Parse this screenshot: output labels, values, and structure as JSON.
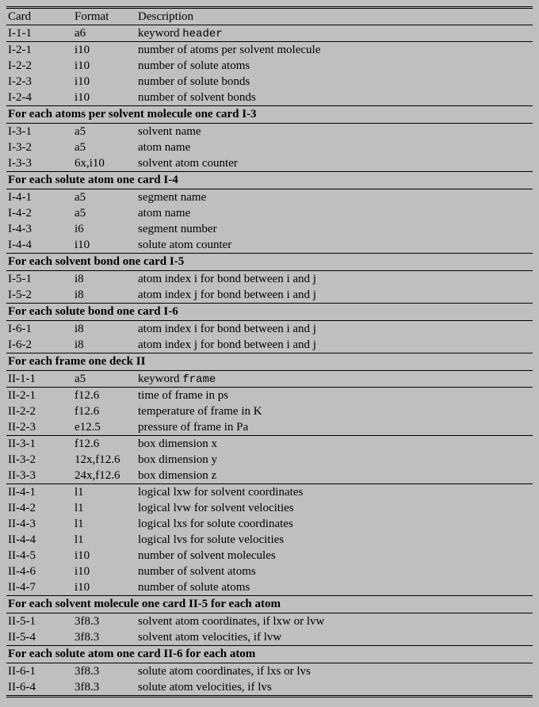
{
  "columns": {
    "card": "Card",
    "format": "Format",
    "description": "Description"
  },
  "rows": [
    {
      "t": "hdr"
    },
    {
      "t": "row",
      "card": "I-1-1",
      "fmt": "a6",
      "desc_pre": "keyword ",
      "desc_tt": "header"
    },
    {
      "t": "rule"
    },
    {
      "t": "row",
      "card": "I-2-1",
      "fmt": "i10",
      "desc": "number of atoms per solvent molecule"
    },
    {
      "t": "row",
      "card": "I-2-2",
      "fmt": "i10",
      "desc": "number of solute atoms"
    },
    {
      "t": "row",
      "card": "I-2-3",
      "fmt": "i10",
      "desc": "number of solute bonds"
    },
    {
      "t": "row",
      "card": "I-2-4",
      "fmt": "i10",
      "desc": "number of solvent bonds"
    },
    {
      "t": "section",
      "label": "For each atoms per solvent molecule one card I-3"
    },
    {
      "t": "row",
      "card": "I-3-1",
      "fmt": "a5",
      "desc": "solvent name"
    },
    {
      "t": "row",
      "card": "I-3-2",
      "fmt": "a5",
      "desc": "atom name"
    },
    {
      "t": "row",
      "card": "I-3-3",
      "fmt": "6x,i10",
      "desc": "solvent atom counter"
    },
    {
      "t": "section",
      "label": "For each solute atom one card I-4"
    },
    {
      "t": "row",
      "card": "I-4-1",
      "fmt": "a5",
      "desc": "segment name"
    },
    {
      "t": "row",
      "card": "I-4-2",
      "fmt": "a5",
      "desc": "atom name"
    },
    {
      "t": "row",
      "card": "I-4-3",
      "fmt": "i6",
      "desc": "segment number"
    },
    {
      "t": "row",
      "card": "I-4-4",
      "fmt": "i10",
      "desc": "solute atom counter"
    },
    {
      "t": "section",
      "label": "For each solvent bond one card I-5"
    },
    {
      "t": "row",
      "card": "I-5-1",
      "fmt": "i8",
      "desc": "atom index i for bond between i and j"
    },
    {
      "t": "row",
      "card": "I-5-2",
      "fmt": "i8",
      "desc": "atom index j for bond between i and j"
    },
    {
      "t": "section",
      "label": "For each solute bond one card I-6"
    },
    {
      "t": "row",
      "card": "I-6-1",
      "fmt": "i8",
      "desc": "atom index i for bond between i and j"
    },
    {
      "t": "row",
      "card": "I-6-2",
      "fmt": "i8",
      "desc": "atom index j for bond between i and j"
    },
    {
      "t": "section",
      "label": "For each frame one deck II"
    },
    {
      "t": "row",
      "card": "II-1-1",
      "fmt": "a5",
      "desc_pre": "keyword ",
      "desc_tt": "frame"
    },
    {
      "t": "rule"
    },
    {
      "t": "row",
      "card": "II-2-1",
      "fmt": "f12.6",
      "desc": "time of frame in ps"
    },
    {
      "t": "row",
      "card": "II-2-2",
      "fmt": "f12.6",
      "desc": "temperature of frame in K"
    },
    {
      "t": "row",
      "card": "II-2-3",
      "fmt": "e12.5",
      "desc": "pressure of frame in Pa"
    },
    {
      "t": "rule"
    },
    {
      "t": "row",
      "card": "II-3-1",
      "fmt": "f12.6",
      "desc": "box dimension x"
    },
    {
      "t": "row",
      "card": "II-3-2",
      "fmt": "12x,f12.6",
      "desc": "box dimension y"
    },
    {
      "t": "row",
      "card": "II-3-3",
      "fmt": "24x,f12.6",
      "desc": "box dimension z"
    },
    {
      "t": "rule"
    },
    {
      "t": "row",
      "card": "II-4-1",
      "fmt": "l1",
      "desc": "logical lxw for solvent coordinates"
    },
    {
      "t": "row",
      "card": "II-4-2",
      "fmt": "l1",
      "desc": "logical lvw for solvent velocities"
    },
    {
      "t": "row",
      "card": "II-4-3",
      "fmt": "l1",
      "desc": "logical lxs for solute coordinates"
    },
    {
      "t": "row",
      "card": "II-4-4",
      "fmt": "l1",
      "desc": "logical lvs for solute velocities"
    },
    {
      "t": "row",
      "card": "II-4-5",
      "fmt": "i10",
      "desc": "number of solvent molecules"
    },
    {
      "t": "row",
      "card": "II-4-6",
      "fmt": "i10",
      "desc": "number of solvent atoms"
    },
    {
      "t": "row",
      "card": "II-4-7",
      "fmt": "i10",
      "desc": "number of solute atoms"
    },
    {
      "t": "section",
      "label": "For each solvent molecule one card II-5 for each atom"
    },
    {
      "t": "row",
      "card": "II-5-1",
      "fmt": "3f8.3",
      "desc": "solvent atom coordinates, if lxw or lvw"
    },
    {
      "t": "row",
      "card": "II-5-4",
      "fmt": "3f8.3",
      "desc": "solvent atom velocities, if lvw"
    },
    {
      "t": "section",
      "label": "For each solute atom one card II-6 for each atom"
    },
    {
      "t": "row",
      "card": "II-6-1",
      "fmt": "3f8.3",
      "desc": "solute atom coordinates, if lxs or lvs"
    },
    {
      "t": "row",
      "card": "II-6-4",
      "fmt": "3f8.3",
      "desc": "solute atom velocities, if lvs"
    }
  ]
}
